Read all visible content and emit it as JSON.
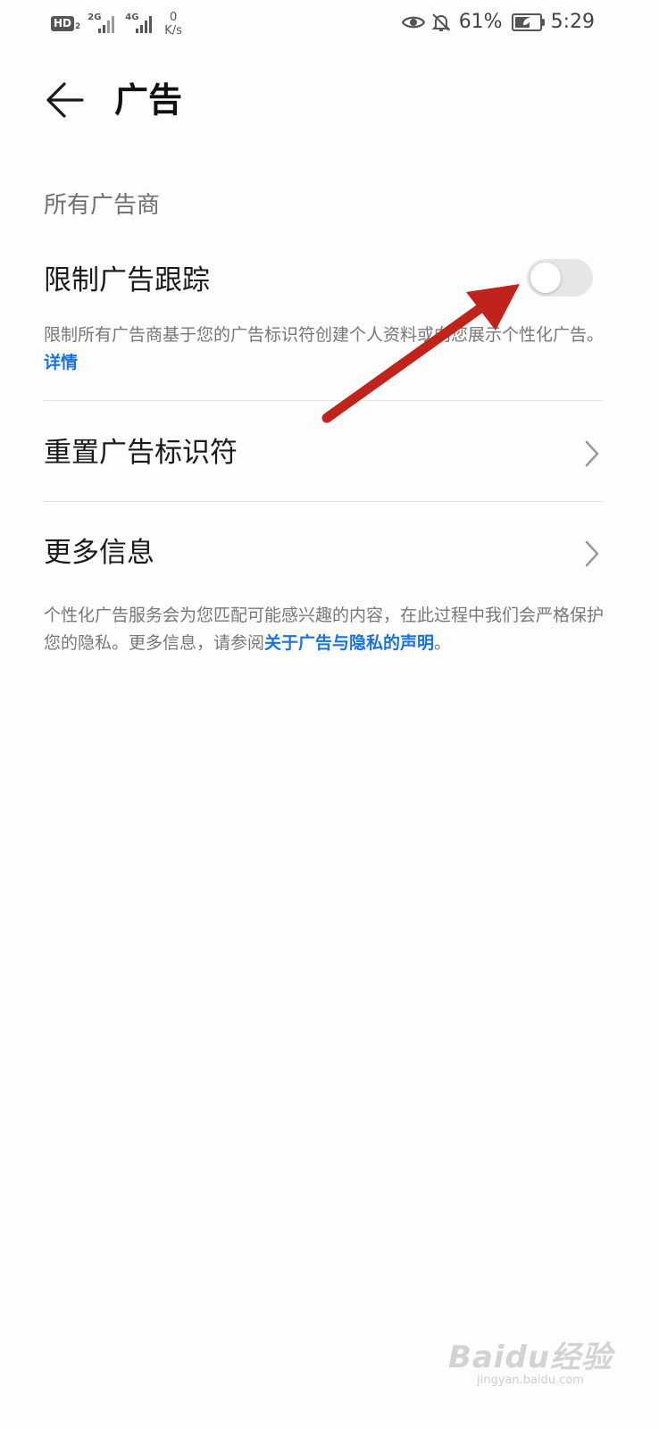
{
  "status_bar": {
    "hd_label": "HD",
    "hd_sub": "2",
    "sim1_gen": "2G",
    "sim2_gen": "4G",
    "net_speed_value": "0",
    "net_speed_unit": "K/s",
    "battery_percent": "61%",
    "battery_level": 0.61,
    "time": "5:29",
    "icons": [
      "hd-icon",
      "signal-icon",
      "signal-icon",
      "eye-icon",
      "bell-off-icon",
      "battery-icon"
    ]
  },
  "header": {
    "back_icon": "arrow-left-icon",
    "title": "广告"
  },
  "section": {
    "title": "所有广告商"
  },
  "limit_tracking": {
    "label": "限制广告跟踪",
    "toggle_on": false,
    "description": "限制所有广告商基于您的广告标识符创建个人资料或向您展示个性化广告。",
    "link_text": "详情"
  },
  "menu": {
    "reset_id_label": "重置广告标识符",
    "more_info_label": "更多信息",
    "chevron_icon": "chevron-right-icon"
  },
  "footer_note": {
    "text": "个性化广告服务会为您匹配可能感兴趣的内容，在此过程中我们会严格保护您的隐私。更多信息，请参阅",
    "link_text": "关于广告与隐私的声明",
    "suffix": "。"
  },
  "annotation": {
    "arrow_color": "#c0231c"
  },
  "watermark": {
    "logo": "Baidu经验",
    "url": "jingyan.baidu.com"
  },
  "colors": {
    "link": "#1a73d6",
    "toggle_off_track": "#e6e6e6",
    "secondary_text": "#777777"
  }
}
